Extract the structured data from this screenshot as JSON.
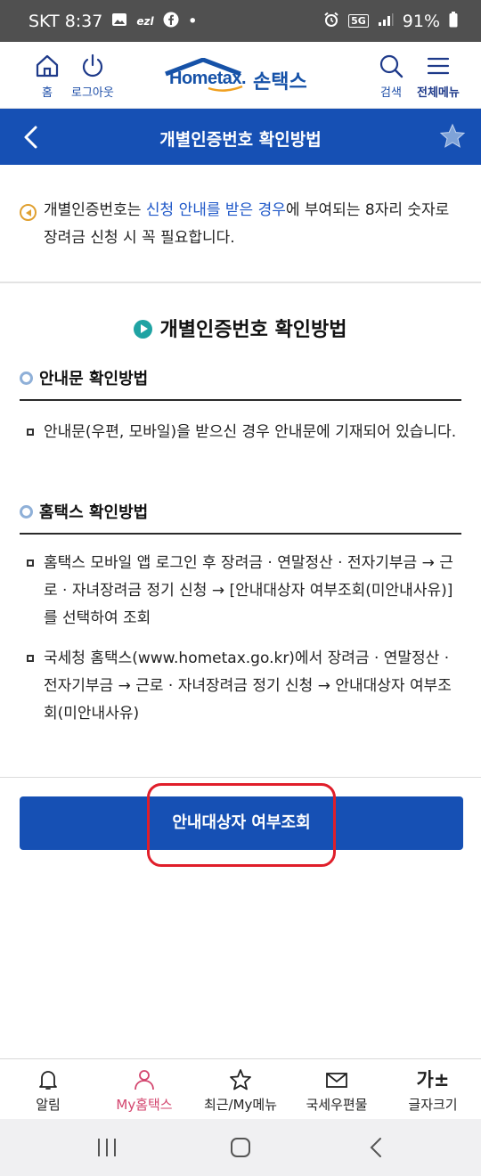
{
  "status_bar": {
    "carrier_time": "SKT 8:37",
    "left_extra": "ezl",
    "dot": "•",
    "network": "5G",
    "battery": "91%"
  },
  "header": {
    "home_label": "홈",
    "logout_label": "로그아웃",
    "logo_text": "Hometax.",
    "logo_kr": "손택스",
    "search_label": "검색",
    "menu_label": "전체메뉴"
  },
  "title_bar": {
    "title": "개별인증번호 확인방법"
  },
  "notice": {
    "text_1": "개별인증번호는 ",
    "text_highlight": "신청 안내를 받은 경우",
    "text_2": "에 부여되는 8자리 숫자로 장려금 신청 시 꼭 필요합니다."
  },
  "section": {
    "title": "개별인증번호 확인방법",
    "sub1_title": "안내문 확인방법",
    "sub1_items": [
      "안내문(우편, 모바일)을 받으신 경우 안내문에 기재되어 있습니다."
    ],
    "sub2_title": "홈택스 확인방법",
    "sub2_items": [
      "홈택스 모바일 앱 로그인 후 장려금 · 연말정산 · 전자기부금 → 근로 · 자녀장려금 정기 신청 → [안내대상자 여부조회(미안내사유)] 를 선택하여 조회",
      "국세청 홈택스(www.hometax.go.kr)에서 장려금 · 연말정산 · 전자기부금 → 근로 · 자녀장려금 정기 신청 → 안내대상자 여부조회(미안내사유)"
    ]
  },
  "primary_button": {
    "label": "안내대상자 여부조회"
  },
  "bottom_nav": {
    "items": [
      {
        "label": "알림"
      },
      {
        "label": "My홈택스"
      },
      {
        "label": "최근/My메뉴"
      },
      {
        "label": "국세우편물"
      },
      {
        "label": "글자크기",
        "glyph": "가±"
      }
    ]
  },
  "colors": {
    "brand_blue": "#1650b4",
    "active_pink": "#d3456e",
    "highlight_red": "#e01e2a"
  }
}
